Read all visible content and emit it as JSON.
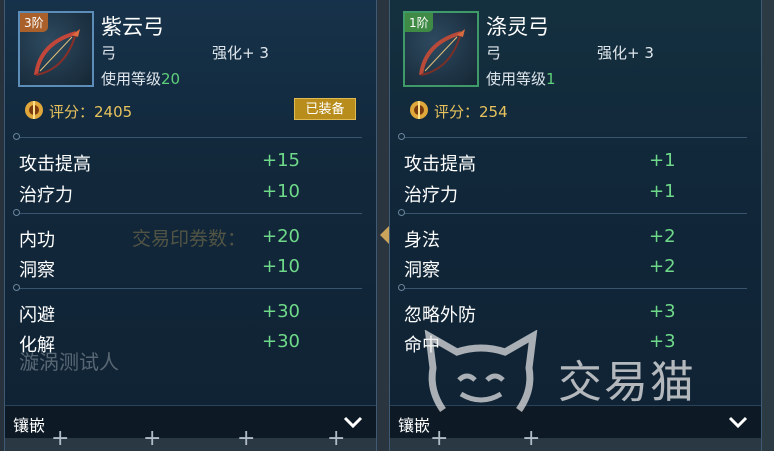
{
  "left": {
    "tier": "3阶",
    "name": "紫云弓",
    "type": "弓",
    "enhance": "强化+ 3",
    "level_label": "使用等级",
    "level_value": "20",
    "score": "评分：2405",
    "equipped": "已装备",
    "stats": [
      {
        "name": "攻击提高",
        "value": "+15"
      },
      {
        "name": "治疗力",
        "value": "+10"
      },
      {
        "name": "内功",
        "value": "+20"
      },
      {
        "name": "洞察",
        "value": "+10"
      },
      {
        "name": "闪避",
        "value": "+30"
      },
      {
        "name": "化解",
        "value": "+30"
      }
    ],
    "inlay": "镶嵌"
  },
  "right": {
    "tier": "1阶",
    "name": "涤灵弓",
    "type": "弓",
    "enhance": "强化+ 3",
    "level_label": "使用等级",
    "level_value": "1",
    "score": "评分：254",
    "stats": [
      {
        "name": "攻击提高",
        "value": "+1"
      },
      {
        "name": "治疗力",
        "value": "+1"
      },
      {
        "name": "身法",
        "value": "+2"
      },
      {
        "name": "洞察",
        "value": "+2"
      },
      {
        "name": "忽略外防",
        "value": "+3"
      },
      {
        "name": "命中",
        "value": "+3"
      }
    ],
    "inlay": "镶嵌"
  },
  "background": {
    "trade_label": "交易印券数：",
    "tester": "漩涡测试人"
  },
  "watermark": {
    "text": "交易猫"
  },
  "colors": {
    "score": "#e7c25d",
    "stat_value": "#6fd98a",
    "equipped_bg": "#b88d1c"
  }
}
